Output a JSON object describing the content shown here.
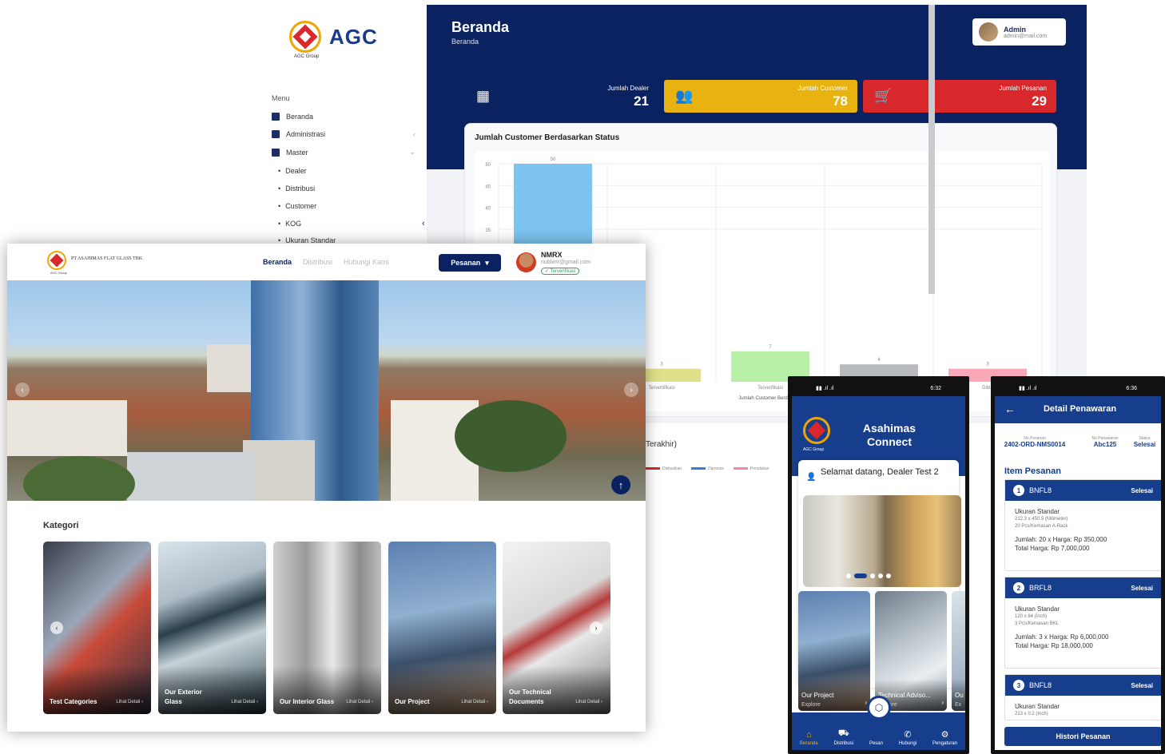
{
  "admin": {
    "brand": "AGC",
    "brand_sub": "AGC Group",
    "menu_title": "Menu",
    "menu": [
      {
        "label": "Beranda"
      },
      {
        "label": "Administrasi"
      },
      {
        "label": "Master"
      }
    ],
    "master_items": [
      "Dealer",
      "Distribusi",
      "Customer",
      "KOG",
      "Ukuran Standar"
    ],
    "page_title": "Beranda",
    "breadcrumb": "Beranda",
    "user": {
      "name": "Admin",
      "email": "admin@mail.com"
    },
    "stats": [
      {
        "label": "Jumlah Dealer",
        "value": "21",
        "color": "#0b2260"
      },
      {
        "label": "Jumlah Customer",
        "value": "78",
        "color": "#e8b310"
      },
      {
        "label": "Jumlah Pesanan",
        "value": "29",
        "color": "#d8282b"
      }
    ],
    "chart_title": "Jumlah Customer Berdasarkan Status",
    "second_title": "Terakhir)"
  },
  "chart_data": {
    "type": "bar",
    "title": "Jumlah Customer Berdasarkan Status",
    "y_ticks": [
      "50",
      "45",
      "40",
      "35"
    ],
    "categories": [
      "",
      "Tervertifikasi",
      "Terverifikasi",
      "",
      "Dibla"
    ],
    "values": [
      50,
      3,
      7,
      4,
      3
    ],
    "colors": [
      "#7cc4ef",
      "#e0e08a",
      "#b9f0a8",
      "#b7b9bd",
      "#f9a8b8"
    ],
    "xlabel": "Jumlah Customer Berdasarka",
    "ylim": [
      0,
      50
    ],
    "grid": true,
    "legend": [
      "Diskusikan",
      "Diproses",
      "Penolakan"
    ],
    "legend_colors": [
      "#d8282b",
      "#3a7bd5",
      "#f08aa0"
    ]
  },
  "web": {
    "brand": "PT ASAHIMAS FLAT GLASS TBK",
    "brand_sub": "AGC Group",
    "nav": [
      "Beranda",
      "Distribusi",
      "Hubungi Kami"
    ],
    "pesan_label": "Pesanan",
    "user": {
      "name": "NMRX",
      "email": "nublimr@gmail.com",
      "badge": "✓ Terverifikasi"
    },
    "hero_prev": "‹",
    "hero_next": "›",
    "to_top": "↑",
    "kategori_title": "Kategori",
    "categories": [
      {
        "name": "Test Categories",
        "link": "Lihat Detail ›"
      },
      {
        "name": "Our Exterior Glass",
        "link": "Lihat Detail ›"
      },
      {
        "name": "Our Interior Glass",
        "link": "Lihat Detail ›"
      },
      {
        "name": "Our Project",
        "link": "Lihat Detail ›"
      },
      {
        "name": "Our Technical Documents",
        "link": "Lihat Detail ›"
      }
    ]
  },
  "phone1": {
    "time": "6:32",
    "app_title": "Asahimas Connect",
    "logo_sub": "AGC Group",
    "greeting": "Selamat datang, Dealer Test 2",
    "tiles": [
      {
        "name": "Our Project",
        "sub": "Explore"
      },
      {
        "name": "Technical Adviso...",
        "sub": "Explore"
      },
      {
        "name": "Ou",
        "sub": "Ex"
      }
    ],
    "nav": [
      "Beranda",
      "Distribusi",
      "Pesan",
      "Hubungi",
      "Pengaturan"
    ]
  },
  "phone2": {
    "time": "6:36",
    "title": "Detail Penawaran",
    "meta": [
      {
        "label": "No Pesanan",
        "value": "2402-ORD-NMS0014"
      },
      {
        "label": "No Penawaran",
        "value": "Abc125"
      },
      {
        "label": "Status",
        "value": "Selesai"
      }
    ],
    "section": "Item Pesanan",
    "items": [
      {
        "no": "1",
        "code": "BNFL8",
        "status": "Selesai",
        "type": "Ukuran Standar",
        "size": "212.3 x 450.5 (Milimeter)",
        "pack": "20 Pcs/Kemasan A-Rack",
        "qty": "Jumlah: 20 x Harga: Rp 350,000",
        "total": "Total Harga: Rp 7,000,000"
      },
      {
        "no": "2",
        "code": "BRFL8",
        "status": "Selesai",
        "type": "Ukuran Standar",
        "size": "120 x 84 (Inch)",
        "pack": "3 Pcs/Kemasan BKL",
        "qty": "Jumlah: 3 x Harga: Rp 6,000,000",
        "total": "Total Harga: Rp 18,000,000"
      },
      {
        "no": "3",
        "code": "BNFL8",
        "status": "Selesai",
        "type": "Ukuran Standar",
        "size": "213 x 0.2 (Inch)",
        "pack": "",
        "qty": "",
        "total": ""
      }
    ],
    "history_btn": "Histori Pesanan"
  }
}
